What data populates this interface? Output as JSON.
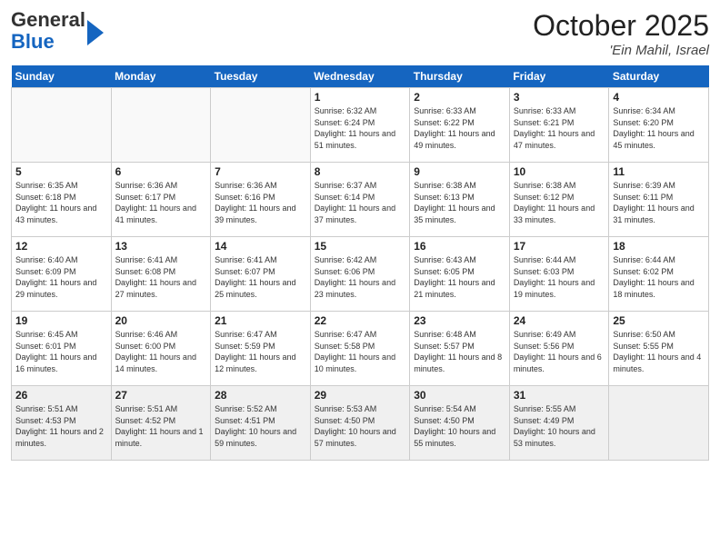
{
  "header": {
    "logo_general": "General",
    "logo_blue": "Blue",
    "month": "October 2025",
    "location": "'Ein Mahil, Israel"
  },
  "days_of_week": [
    "Sunday",
    "Monday",
    "Tuesday",
    "Wednesday",
    "Thursday",
    "Friday",
    "Saturday"
  ],
  "weeks": [
    [
      {
        "day": null
      },
      {
        "day": null
      },
      {
        "day": null
      },
      {
        "day": "1",
        "sunrise": "6:32 AM",
        "sunset": "6:24 PM",
        "daylight": "11 hours and 51 minutes."
      },
      {
        "day": "2",
        "sunrise": "6:33 AM",
        "sunset": "6:22 PM",
        "daylight": "11 hours and 49 minutes."
      },
      {
        "day": "3",
        "sunrise": "6:33 AM",
        "sunset": "6:21 PM",
        "daylight": "11 hours and 47 minutes."
      },
      {
        "day": "4",
        "sunrise": "6:34 AM",
        "sunset": "6:20 PM",
        "daylight": "11 hours and 45 minutes."
      }
    ],
    [
      {
        "day": "5",
        "sunrise": "6:35 AM",
        "sunset": "6:18 PM",
        "daylight": "11 hours and 43 minutes."
      },
      {
        "day": "6",
        "sunrise": "6:36 AM",
        "sunset": "6:17 PM",
        "daylight": "11 hours and 41 minutes."
      },
      {
        "day": "7",
        "sunrise": "6:36 AM",
        "sunset": "6:16 PM",
        "daylight": "11 hours and 39 minutes."
      },
      {
        "day": "8",
        "sunrise": "6:37 AM",
        "sunset": "6:14 PM",
        "daylight": "11 hours and 37 minutes."
      },
      {
        "day": "9",
        "sunrise": "6:38 AM",
        "sunset": "6:13 PM",
        "daylight": "11 hours and 35 minutes."
      },
      {
        "day": "10",
        "sunrise": "6:38 AM",
        "sunset": "6:12 PM",
        "daylight": "11 hours and 33 minutes."
      },
      {
        "day": "11",
        "sunrise": "6:39 AM",
        "sunset": "6:11 PM",
        "daylight": "11 hours and 31 minutes."
      }
    ],
    [
      {
        "day": "12",
        "sunrise": "6:40 AM",
        "sunset": "6:09 PM",
        "daylight": "11 hours and 29 minutes."
      },
      {
        "day": "13",
        "sunrise": "6:41 AM",
        "sunset": "6:08 PM",
        "daylight": "11 hours and 27 minutes."
      },
      {
        "day": "14",
        "sunrise": "6:41 AM",
        "sunset": "6:07 PM",
        "daylight": "11 hours and 25 minutes."
      },
      {
        "day": "15",
        "sunrise": "6:42 AM",
        "sunset": "6:06 PM",
        "daylight": "11 hours and 23 minutes."
      },
      {
        "day": "16",
        "sunrise": "6:43 AM",
        "sunset": "6:05 PM",
        "daylight": "11 hours and 21 minutes."
      },
      {
        "day": "17",
        "sunrise": "6:44 AM",
        "sunset": "6:03 PM",
        "daylight": "11 hours and 19 minutes."
      },
      {
        "day": "18",
        "sunrise": "6:44 AM",
        "sunset": "6:02 PM",
        "daylight": "11 hours and 18 minutes."
      }
    ],
    [
      {
        "day": "19",
        "sunrise": "6:45 AM",
        "sunset": "6:01 PM",
        "daylight": "11 hours and 16 minutes."
      },
      {
        "day": "20",
        "sunrise": "6:46 AM",
        "sunset": "6:00 PM",
        "daylight": "11 hours and 14 minutes."
      },
      {
        "day": "21",
        "sunrise": "6:47 AM",
        "sunset": "5:59 PM",
        "daylight": "11 hours and 12 minutes."
      },
      {
        "day": "22",
        "sunrise": "6:47 AM",
        "sunset": "5:58 PM",
        "daylight": "11 hours and 10 minutes."
      },
      {
        "day": "23",
        "sunrise": "6:48 AM",
        "sunset": "5:57 PM",
        "daylight": "11 hours and 8 minutes."
      },
      {
        "day": "24",
        "sunrise": "6:49 AM",
        "sunset": "5:56 PM",
        "daylight": "11 hours and 6 minutes."
      },
      {
        "day": "25",
        "sunrise": "6:50 AM",
        "sunset": "5:55 PM",
        "daylight": "11 hours and 4 minutes."
      }
    ],
    [
      {
        "day": "26",
        "sunrise": "5:51 AM",
        "sunset": "4:53 PM",
        "daylight": "11 hours and 2 minutes."
      },
      {
        "day": "27",
        "sunrise": "5:51 AM",
        "sunset": "4:52 PM",
        "daylight": "11 hours and 1 minute."
      },
      {
        "day": "28",
        "sunrise": "5:52 AM",
        "sunset": "4:51 PM",
        "daylight": "10 hours and 59 minutes."
      },
      {
        "day": "29",
        "sunrise": "5:53 AM",
        "sunset": "4:50 PM",
        "daylight": "10 hours and 57 minutes."
      },
      {
        "day": "30",
        "sunrise": "5:54 AM",
        "sunset": "4:50 PM",
        "daylight": "10 hours and 55 minutes."
      },
      {
        "day": "31",
        "sunrise": "5:55 AM",
        "sunset": "4:49 PM",
        "daylight": "10 hours and 53 minutes."
      },
      {
        "day": null
      }
    ]
  ]
}
